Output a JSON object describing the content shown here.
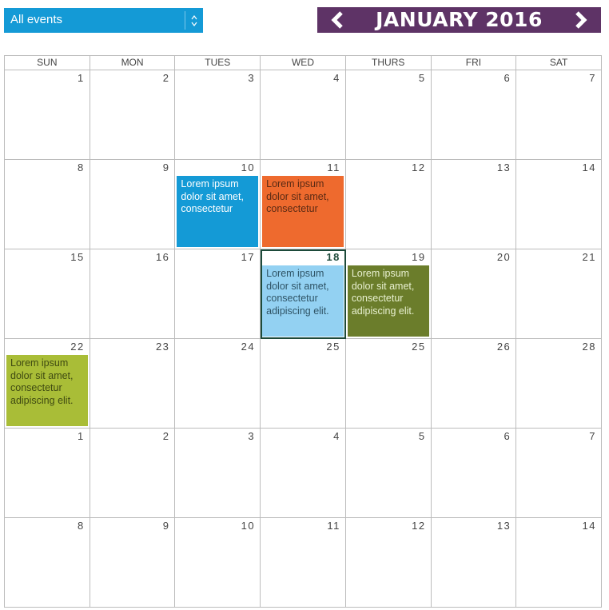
{
  "filter": {
    "selected": "All events",
    "color": "#149ad6"
  },
  "header": {
    "month_title": "JANUARY 2016",
    "prev_icon": "chevron-left-icon",
    "next_icon": "chevron-right-icon",
    "color": "#5e3366"
  },
  "weekdays": [
    "SUN",
    "MON",
    "TUES",
    "WED",
    "THURS",
    "FRI",
    "SAT"
  ],
  "weeks": [
    [
      {
        "n": "1"
      },
      {
        "n": "2"
      },
      {
        "n": "3"
      },
      {
        "n": "4"
      },
      {
        "n": "5"
      },
      {
        "n": "6"
      },
      {
        "n": "7"
      }
    ],
    [
      {
        "n": "8"
      },
      {
        "n": "9"
      },
      {
        "n": "10",
        "event": {
          "text": "Lorem ipsum dolor sit amet, consectetur",
          "bg": "#149ad6",
          "fg": "#ffffff"
        }
      },
      {
        "n": "11",
        "event": {
          "text": "Lorem ipsum dolor sit amet, consectetur",
          "bg": "#ee6a2e",
          "fg": "#5a2a14"
        }
      },
      {
        "n": "12"
      },
      {
        "n": "13"
      },
      {
        "n": "14"
      }
    ],
    [
      {
        "n": "15"
      },
      {
        "n": "16"
      },
      {
        "n": "17"
      },
      {
        "n": "18",
        "today": true,
        "event": {
          "text": "Lorem ipsum dolor sit amet, consectetur adipiscing elit.",
          "bg": "#93d1f2",
          "fg": "#2f5466"
        }
      },
      {
        "n": "19",
        "event": {
          "text": "Lorem ipsum dolor sit amet, consectetur adipiscing elit.",
          "bg": "#6b7d2b",
          "fg": "#e8f0d0"
        }
      },
      {
        "n": "20"
      },
      {
        "n": "21"
      }
    ],
    [
      {
        "n": "22",
        "event": {
          "text": "Lorem ipsum dolor sit amet, consectetur adipiscing elit.",
          "bg": "#a9bd37",
          "fg": "#3f4a12"
        }
      },
      {
        "n": "23"
      },
      {
        "n": "24"
      },
      {
        "n": "25"
      },
      {
        "n": "25"
      },
      {
        "n": "26"
      },
      {
        "n": "28"
      }
    ],
    [
      {
        "n": "1"
      },
      {
        "n": "2"
      },
      {
        "n": "3"
      },
      {
        "n": "4"
      },
      {
        "n": "5"
      },
      {
        "n": "6"
      },
      {
        "n": "7"
      }
    ],
    [
      {
        "n": "8"
      },
      {
        "n": "9"
      },
      {
        "n": "10"
      },
      {
        "n": "11"
      },
      {
        "n": "12"
      },
      {
        "n": "13"
      },
      {
        "n": "14"
      }
    ]
  ]
}
